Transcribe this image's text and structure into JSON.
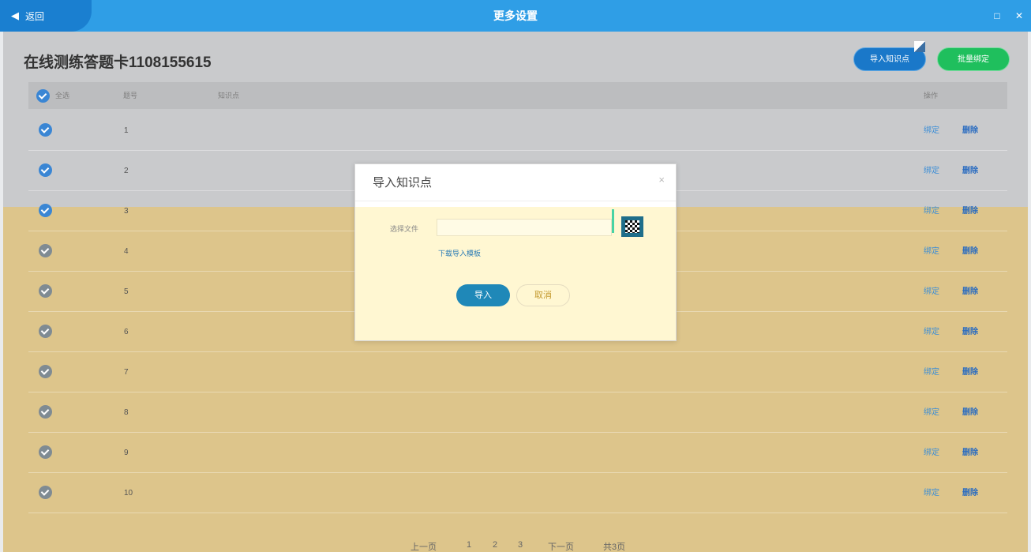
{
  "window": {
    "title": "更多设置",
    "back_label": "返回",
    "back_arrow": "◀",
    "restore_glyph": "□",
    "close_glyph": "✕"
  },
  "page": {
    "title": "在线测练答题卡1108155615",
    "import_button": "导入知识点",
    "batch_bind_button": "批量绑定"
  },
  "table": {
    "headers": {
      "select_all": "全选",
      "number": "题号",
      "knowledge_point": "知识点",
      "operation": "操作"
    },
    "rows": [
      {
        "num": "1",
        "bind": "绑定",
        "delete": "删除"
      },
      {
        "num": "2",
        "bind": "绑定",
        "delete": "删除"
      },
      {
        "num": "3",
        "bind": "绑定",
        "delete": "删除"
      },
      {
        "num": "4",
        "bind": "绑定",
        "delete": "删除"
      },
      {
        "num": "5",
        "bind": "绑定",
        "delete": "删除"
      },
      {
        "num": "6",
        "bind": "绑定",
        "delete": "删除"
      },
      {
        "num": "7",
        "bind": "绑定",
        "delete": "删除"
      },
      {
        "num": "8",
        "bind": "绑定",
        "delete": "删除"
      },
      {
        "num": "9",
        "bind": "绑定",
        "delete": "删除"
      },
      {
        "num": "10",
        "bind": "绑定",
        "delete": "删除"
      }
    ]
  },
  "pager": {
    "prev": "上一页",
    "pages": [
      "1",
      "2",
      "3"
    ],
    "next": "下一页",
    "total": "共3页"
  },
  "modal": {
    "title": "导入知识点",
    "close_glyph": "×",
    "file_label": "选择文件",
    "file_value": "",
    "template_link": "下载导入模板",
    "ok_button": "导入",
    "cancel_button": "取消"
  },
  "colors": {
    "titlebar": "#2f9ee6",
    "import_button": "#1a78c9",
    "batch_button": "#1fbf5d",
    "ok_button": "#1f88b8"
  }
}
